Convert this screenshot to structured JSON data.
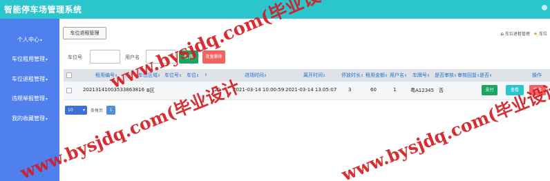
{
  "app": {
    "title": "智能停车场管理系统"
  },
  "sidebar": {
    "items": [
      {
        "label": "个人中心"
      },
      {
        "label": "车位租用管理"
      },
      {
        "label": "车位退租管理"
      },
      {
        "label": "违规举报管理"
      },
      {
        "label": "我的收藏管理"
      }
    ]
  },
  "tab": {
    "label": "车位退租管理"
  },
  "breadcrumb": {
    "home_icon": "⌂",
    "items": [
      "车位退租管理",
      "车位"
    ]
  },
  "filters": {
    "spot_label": "车位号",
    "spot_value": "",
    "user_label": "用户名",
    "user_value": "",
    "search_label": "查询",
    "delete_label": "批量删除"
  },
  "table": {
    "headers": [
      "租用编号",
      "车位区域",
      "车位号",
      "车位",
      "",
      "进场时间",
      "离开时间",
      "停放时长",
      "租用金额",
      "用户名",
      "车牌号",
      "是否审核",
      "审核回复",
      "是否",
      "操作"
    ],
    "rows": [
      {
        "id": "20213141003533863816",
        "area": "B区",
        "spot": "",
        "c4": "",
        "c5": "20",
        "enter_time": "2021-03-14 10:00:59",
        "leave_time": "2021-03-14 13:05:07",
        "duration": "3",
        "amount": "60",
        "user": "1",
        "plate": "粤A12345",
        "audited": "否",
        "reply": "",
        "pay_label": "支付",
        "view_label": "查看",
        "edit_label": "修改"
      }
    ]
  },
  "pager": {
    "size": "10",
    "per_page_text": "条每页",
    "current": "1"
  },
  "watermarks": [
    "www.bysjdq.com(毕业设计大全)",
    "www.bysjdq.com(毕业设计",
    "www.bysjdq.com(毕业设计"
  ],
  "colors": {
    "topbar": "#2bc5cd",
    "sidebar": "#4f80ee",
    "search": "#1aa560",
    "delete": "#f36161",
    "watermark": "#d41d22"
  }
}
